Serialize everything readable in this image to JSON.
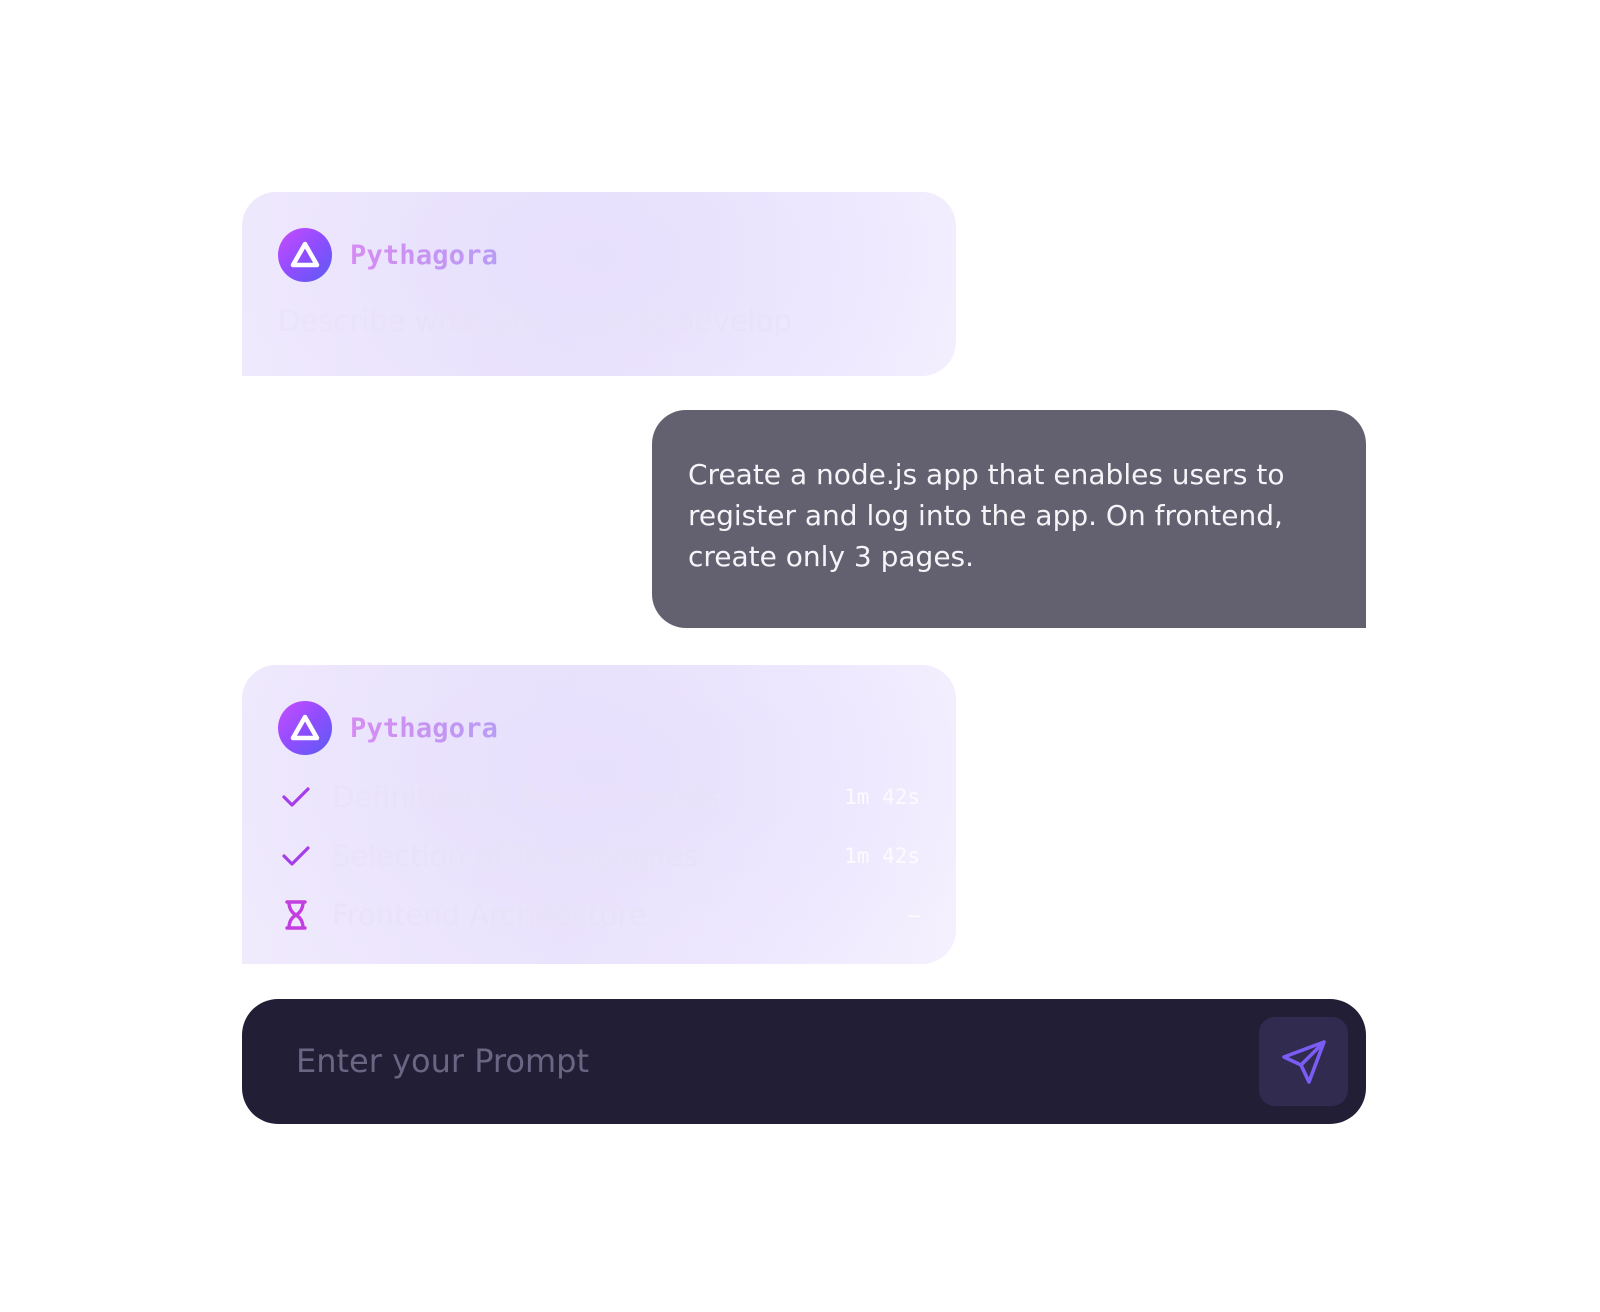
{
  "colors": {
    "accent": "#a54df0",
    "bot_card_bg": "#ece5fd",
    "user_bubble_bg": "#636170",
    "prompt_bar_bg": "#211e35",
    "send_button_bg": "#312b4f",
    "send_icon": "#7b5cf5"
  },
  "messages": [
    {
      "role": "assistant",
      "sender": "Pythagora",
      "avatar_icon": "pythagora-logo-icon",
      "text": "Describe what you want to develop"
    },
    {
      "role": "user",
      "text": "Create a node.js app that enables users to register and log into the app. On frontend, create only 3 pages."
    },
    {
      "role": "assistant",
      "sender": "Pythagora",
      "avatar_icon": "pythagora-logo-icon",
      "tasks": [
        {
          "icon": "checkmark-icon",
          "label": "Definition of Requirements",
          "time": "1m 42s"
        },
        {
          "icon": "checkmark-icon",
          "label": "Selection of Technologies",
          "time": "1m 42s"
        },
        {
          "icon": "hourglass-icon",
          "label": "Frontend Architecture",
          "time": "–"
        }
      ]
    }
  ],
  "prompt": {
    "placeholder": "Enter your Prompt",
    "value": "",
    "send_icon": "send-icon"
  }
}
